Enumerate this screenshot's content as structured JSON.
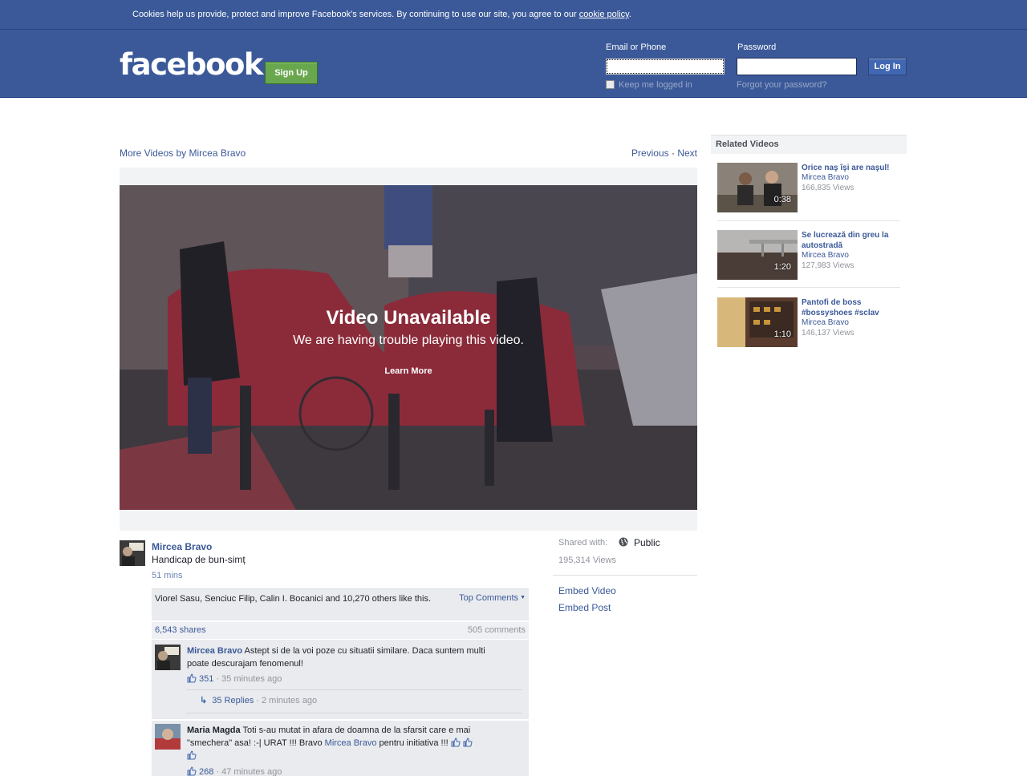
{
  "cookie_bar": {
    "text": "Cookies help us provide, protect and improve Facebook's services. By continuing to use our site, you agree to our ",
    "link": "cookie policy",
    "end": "."
  },
  "header": {
    "logo": "facebook",
    "signup": "Sign Up",
    "email_label": "Email or Phone",
    "password_label": "Password",
    "login_button": "Log In",
    "keep_logged_in": "Keep me logged in",
    "forgot_password": "Forgot your password?"
  },
  "nav": {
    "more_videos": "More Videos by Mircea Bravo",
    "previous": "Previous",
    "separator": " · ",
    "next": "Next"
  },
  "video": {
    "title": "Video Unavailable",
    "subtitle": "We are having trouble playing this video.",
    "learn_more": "Learn More"
  },
  "post": {
    "author": "Mircea Bravo",
    "text": "Handicap de bun-simț",
    "time": "51 mins",
    "likes": "Viorel Sasu, Senciuc Filip, Calin I. Bocanici and 10,270 others like this.",
    "top_comments": "Top Comments",
    "shares": "6,543 shares",
    "comments_count": "505 comments"
  },
  "comments": [
    {
      "author": "Mircea Bravo",
      "text": " Astept si de la voi poze cu situatii similare. Daca suntem multi poate descurajam fenomenul!",
      "likes": "351",
      "time": " · 35 minutes ago",
      "replies": "35 Replies",
      "replies_time": " · 2 minutes ago"
    },
    {
      "author": "Maria Magda",
      "text_a": " Toti s-au mutat in afara de doamna de la sfarsit care e mai \"smechera\" asa! :-| URAT !!! Bravo ",
      "mention": "Mircea Bravo",
      "text_b": " pentru initiativa !!! ",
      "likes": "268",
      "time": " · 47 minutes ago"
    }
  ],
  "side": {
    "shared_with": "Shared with:",
    "privacy": "Public",
    "views": "195,314 Views",
    "embed_video": "Embed Video",
    "embed_post": "Embed Post"
  },
  "related": {
    "heading": "Related Videos",
    "items": [
      {
        "title": "Orice naş îşi are naşul!",
        "author": "Mircea Bravo",
        "views": "166,835 Views",
        "duration": "0:38"
      },
      {
        "title": "Se lucrează din greu la autostradă",
        "author": "Mircea Bravo",
        "views": "127,983 Views",
        "duration": "1:20"
      },
      {
        "title": "Pantofi de boss #bossyshoes #sclav",
        "author": "Mircea Bravo",
        "views": "146,137 Views",
        "duration": "1:10"
      }
    ]
  },
  "colors": {
    "brand_blue": "#3b5998",
    "signup_green": "#69a74e"
  }
}
